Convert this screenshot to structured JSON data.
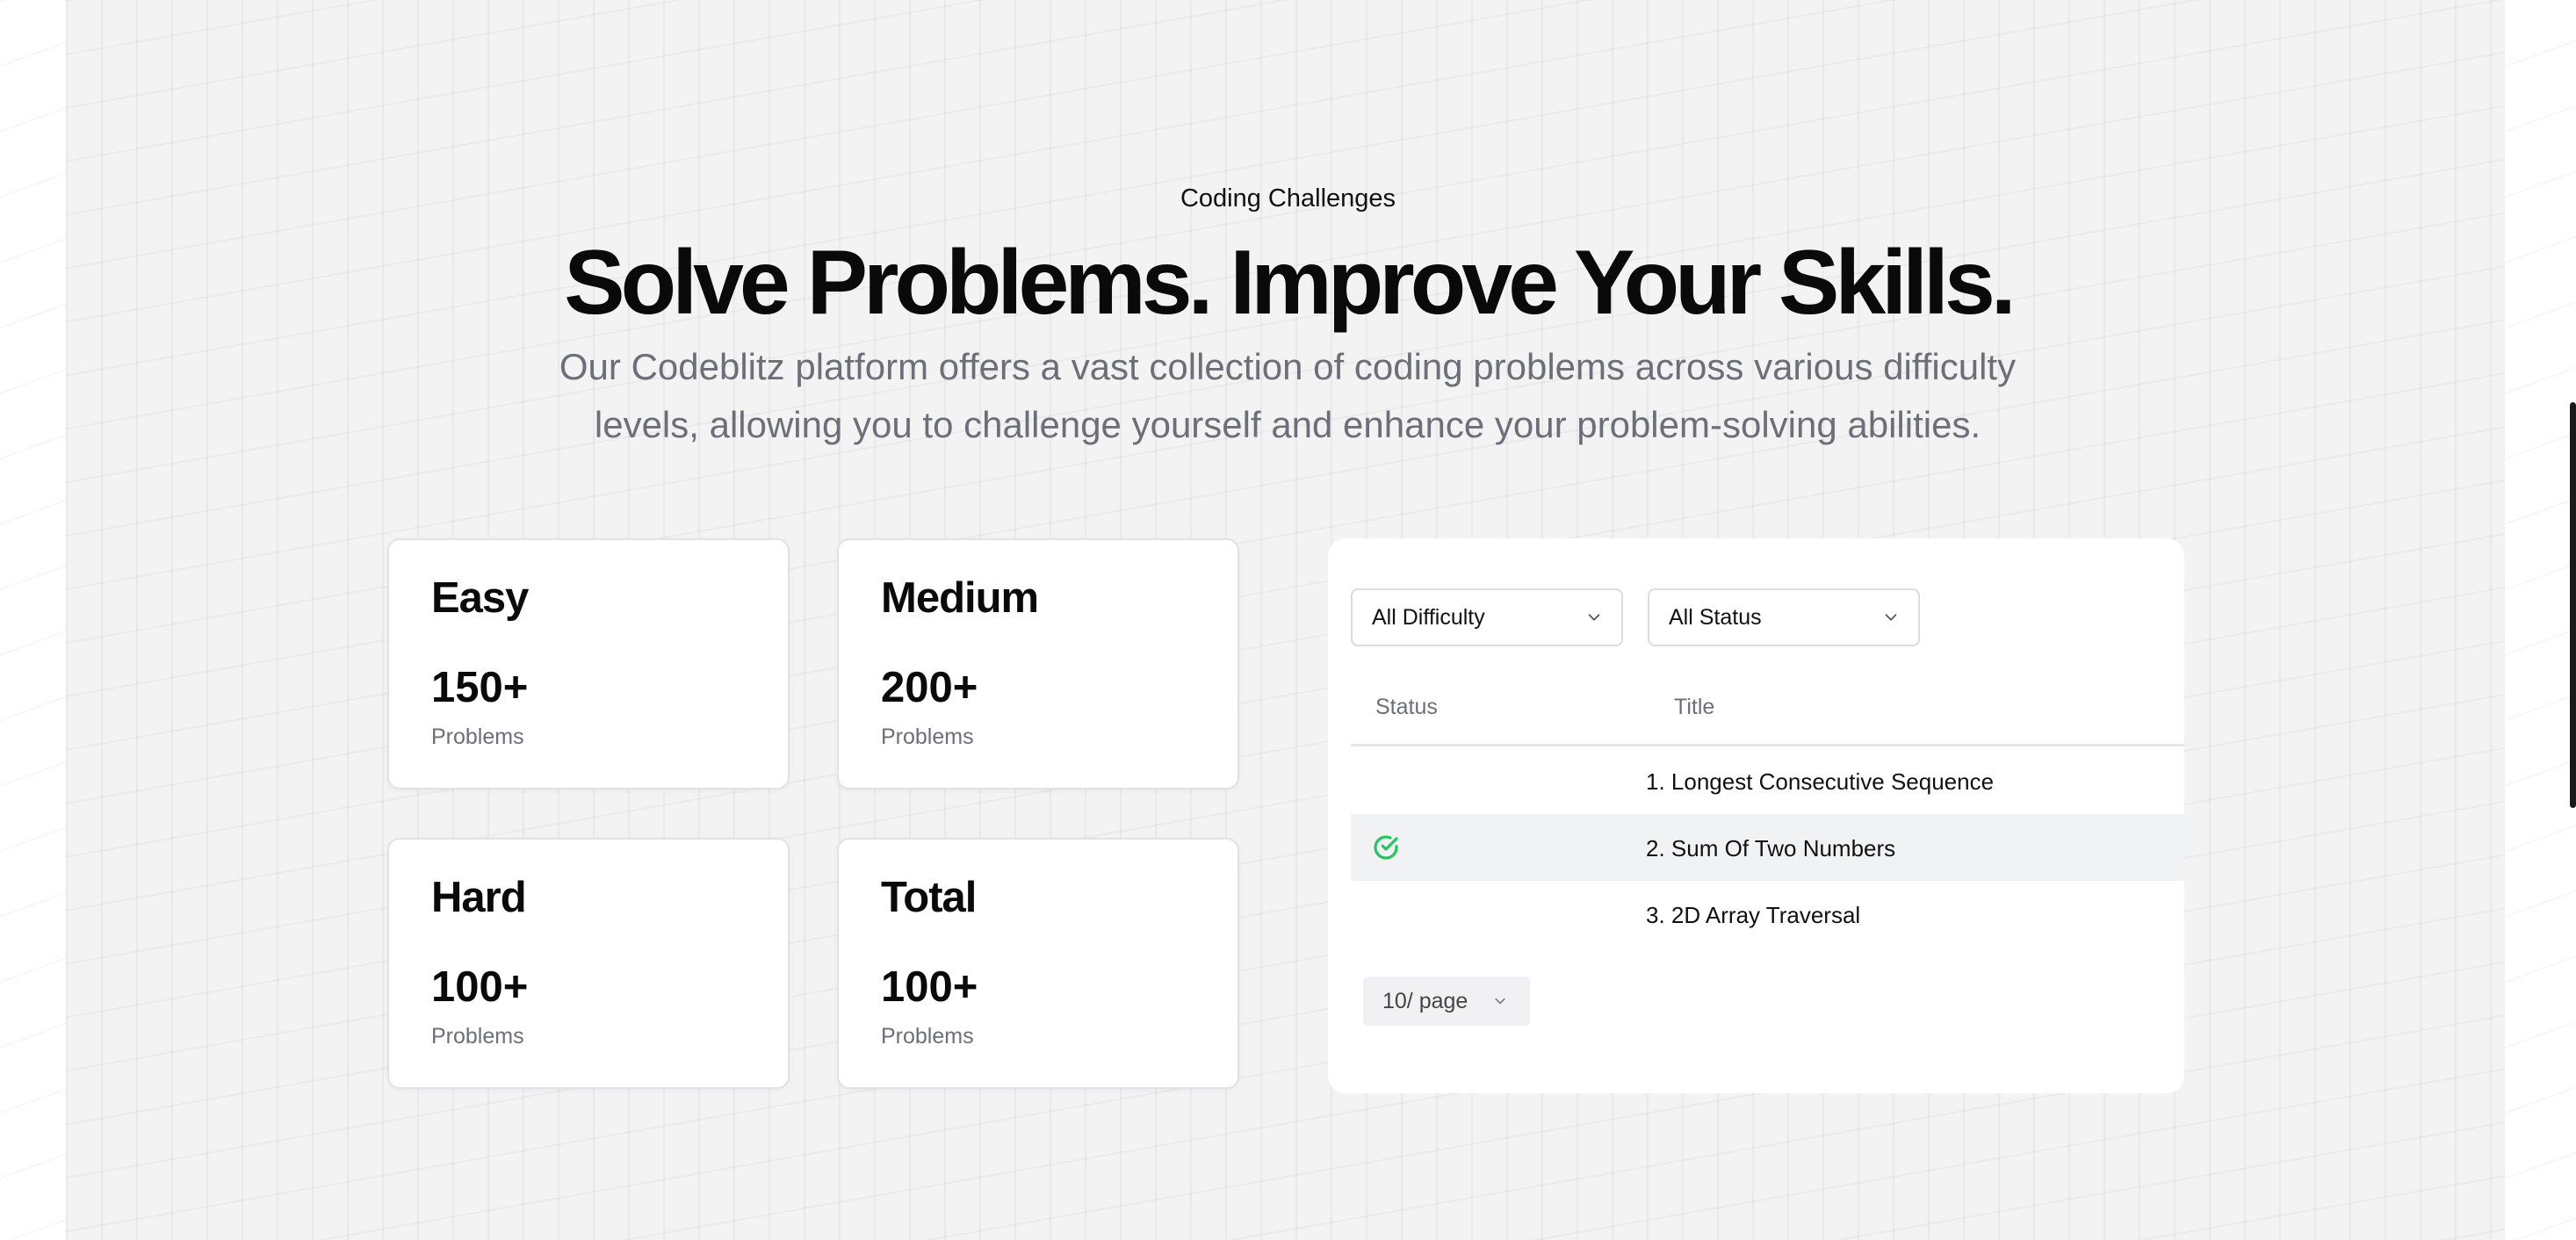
{
  "hero": {
    "eyebrow": "Coding Challenges",
    "headline": "Solve Problems. Improve Your Skills.",
    "subtitle_line1": "Our Codeblitz platform offers a vast collection of coding problems across various difficulty",
    "subtitle_line2": "levels, allowing you to challenge yourself and enhance your problem-solving abilities."
  },
  "stats": [
    {
      "label": "Easy",
      "value": "150+",
      "unit": "Problems"
    },
    {
      "label": "Medium",
      "value": "200+",
      "unit": "Problems"
    },
    {
      "label": "Hard",
      "value": "100+",
      "unit": "Problems"
    },
    {
      "label": "Total",
      "value": "100+",
      "unit": "Problems"
    }
  ],
  "filters": {
    "difficulty": "All Difficulty",
    "status": "All Status"
  },
  "table": {
    "columns": [
      "Status",
      "Title"
    ],
    "rows": [
      {
        "title": "1. Longest Consecutive Sequence",
        "solved": false
      },
      {
        "title": "2. Sum Of Two Numbers",
        "solved": true
      },
      {
        "title": "3. 2D Array Traversal",
        "solved": false
      }
    ]
  },
  "pagination": {
    "page_size": "10/ page"
  },
  "colors": {
    "accent_green": "#22c55e",
    "text_muted": "#6e6e78"
  }
}
